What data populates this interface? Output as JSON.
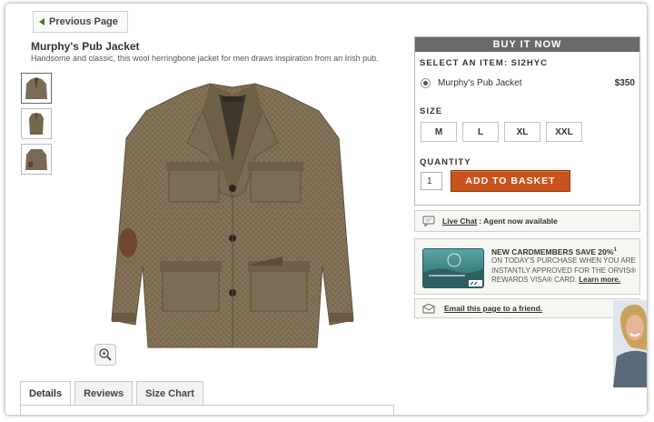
{
  "nav": {
    "previous_page": "Previous Page"
  },
  "product": {
    "title": "Murphy's Pub Jacket",
    "description": "Handsome and classic, this wool herringbone jacket for men draws inspiration from an Irish pub."
  },
  "tabs": [
    {
      "label": "Details"
    },
    {
      "label": "Reviews"
    },
    {
      "label": "Size Chart"
    }
  ],
  "buy_box": {
    "header": "BUY IT NOW",
    "select_item_label": "SELECT AN ITEM: SI2HYC",
    "item": {
      "name": "Murphy's Pub Jacket",
      "price": "$350"
    },
    "size_label": "SIZE",
    "sizes": [
      "M",
      "L",
      "XL",
      "XXL"
    ],
    "quantity_label": "QUANTITY",
    "quantity_value": "1",
    "add_to_basket": "ADD TO BASKET"
  },
  "chat": {
    "link": "Live Chat",
    "status": ": Agent now available"
  },
  "promo": {
    "headline": "NEW CARDMEMBERS SAVE 20%",
    "headline_sup": "1",
    "body": "ON TODAY'S PURCHASE WHEN YOU ARE INSTANTLY APPROVED FOR THE ORVIS® REWARDS VISA® CARD.",
    "learn_more": "Learn more."
  },
  "email": {
    "link": "Email this page to a friend."
  },
  "colors": {
    "accent": "#c9541e",
    "header_bg": "#6a6a6a",
    "nav_arrow": "#4a7a1e"
  }
}
